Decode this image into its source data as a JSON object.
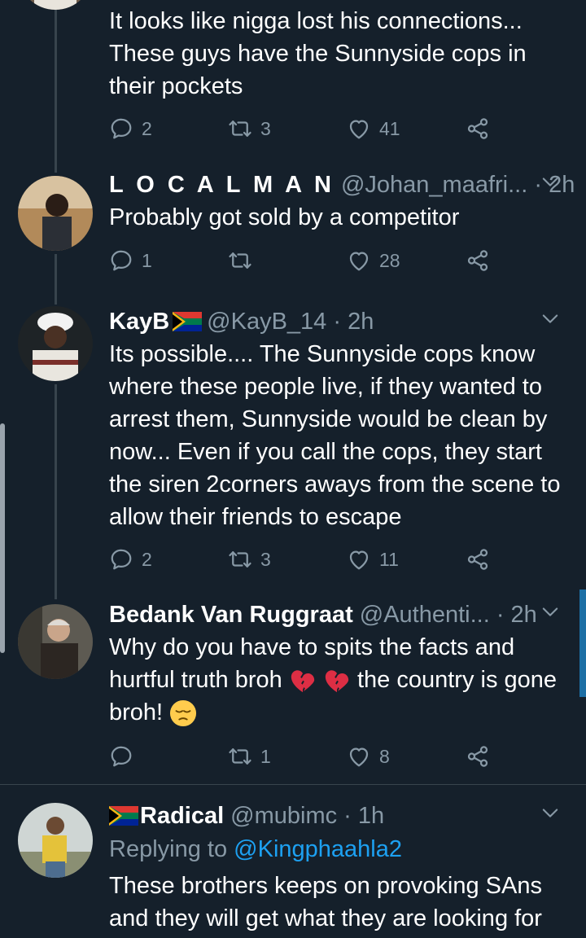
{
  "tweets": [
    {
      "text": "It looks like nigga lost his connections... These guys have the Sunnyside cops in their pockets",
      "replies": "2",
      "retweets": "3",
      "likes": "41"
    },
    {
      "name": "L O C A L M A N",
      "handle": "@Johan_maafri... · 2h",
      "text": "Probably got sold by a competitor",
      "replies": "1",
      "retweets": "",
      "likes": "28"
    },
    {
      "name": "KayB",
      "handle": "@KayB_14 · 2h",
      "text": "Its possible.... The Sunnyside cops know where these people live, if they wanted to arrest them, Sunnyside would be clean by now... Even if you call the cops, they start the siren 2corners aways from the scene to allow their friends to escape",
      "replies": "2",
      "retweets": "3",
      "likes": "11"
    },
    {
      "name": "Bedank Van Ruggraat",
      "handle": "@Authenti... · 2h",
      "text_before": "Why do you have to spits the facts and hurtful truth broh",
      "text_middle": "the country is gone broh!",
      "replies": "",
      "retweets": "1",
      "likes": "8"
    },
    {
      "name": "Radical",
      "handle": "@mubimc · 1h",
      "replying_prefix": "Replying to",
      "replying_mention": "@Kingphaahla2",
      "text": "These brothers keeps on provoking SAns and they will get what they are looking for"
    }
  ],
  "icons": {
    "reply": "reply-icon",
    "retweet": "retweet-icon",
    "like": "heart-icon",
    "share": "share-icon",
    "menu": "chevron-down-icon"
  },
  "colors": {
    "background": "#15202b",
    "secondary_text": "#8899a6",
    "link": "#1da1f2",
    "divider": "#38444d"
  }
}
